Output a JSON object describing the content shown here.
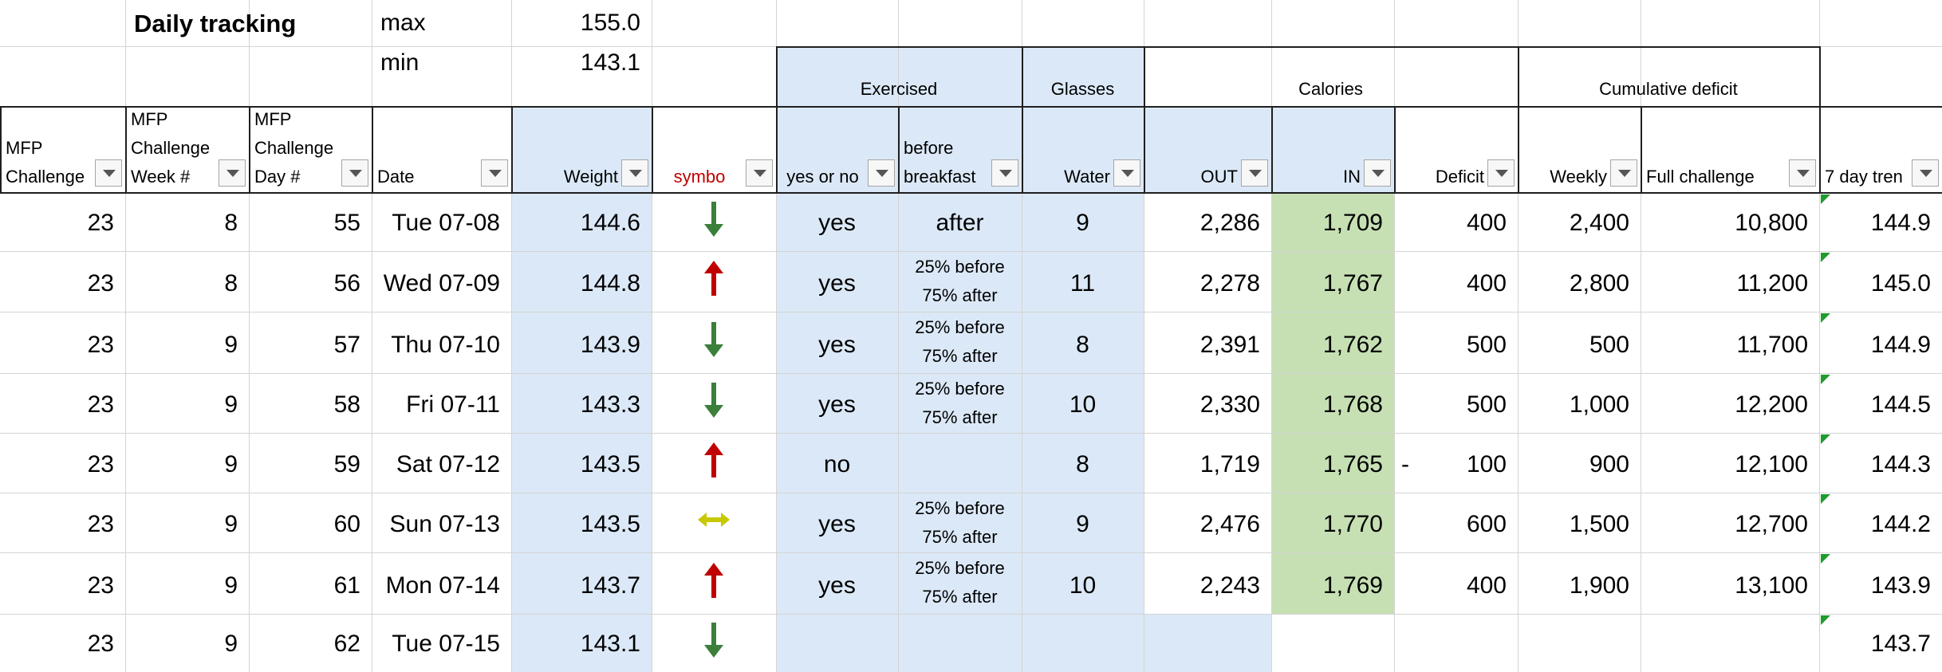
{
  "summary": {
    "title": "Daily tracking",
    "max_label": "max",
    "max_value": "155.0",
    "min_label": "min",
    "min_value": "143.1"
  },
  "group_headers": {
    "exercised": "Exercised",
    "glasses": "Glasses",
    "calories": "Calories",
    "cumulative_deficit": "Cumulative deficit"
  },
  "columns": [
    {
      "key": "challenge",
      "lines": [
        "MFP",
        "Challenge"
      ],
      "align": "l"
    },
    {
      "key": "week",
      "lines": [
        "MFP",
        "Challenge",
        "Week #"
      ],
      "align": "l"
    },
    {
      "key": "day",
      "lines": [
        "MFP",
        "Challenge",
        "Day #"
      ],
      "align": "l"
    },
    {
      "key": "date",
      "lines": [
        "Date"
      ],
      "align": "l"
    },
    {
      "key": "weight",
      "lines": [
        "Weight"
      ],
      "align": "r"
    },
    {
      "key": "symbol",
      "lines": [
        "symbo"
      ],
      "align": "c",
      "color": "red"
    },
    {
      "key": "exercised",
      "lines": [
        "yes or no"
      ],
      "align": "c"
    },
    {
      "key": "before_breakfast",
      "lines": [
        "before",
        "breakfast"
      ],
      "align": "l"
    },
    {
      "key": "water",
      "lines": [
        "Water"
      ],
      "align": "r"
    },
    {
      "key": "out",
      "lines": [
        "OUT"
      ],
      "align": "r"
    },
    {
      "key": "in",
      "lines": [
        "IN"
      ],
      "align": "r"
    },
    {
      "key": "deficit",
      "lines": [
        "Deficit"
      ],
      "align": "r"
    },
    {
      "key": "weekly",
      "lines": [
        "Weekly"
      ],
      "align": "r"
    },
    {
      "key": "full",
      "lines": [
        "Full challenge"
      ],
      "align": "l"
    },
    {
      "key": "trend",
      "lines": [
        "7 day tren"
      ],
      "align": "l"
    }
  ],
  "rows": [
    {
      "challenge": "23",
      "week": "8",
      "day": "55",
      "date": "Tue 07-08",
      "weight": "144.6",
      "symbol": "down",
      "exercised": "yes",
      "before_breakfast": [
        "after"
      ],
      "water": "9",
      "out": "2,286",
      "in": "1,709",
      "deficit_sign": "",
      "deficit": "400",
      "weekly": "2,400",
      "full": "10,800",
      "trend": "144.9"
    },
    {
      "challenge": "23",
      "week": "8",
      "day": "56",
      "date": "Wed 07-09",
      "weight": "144.8",
      "symbol": "up",
      "exercised": "yes",
      "before_breakfast": [
        "25% before",
        "75% after"
      ],
      "water": "11",
      "out": "2,278",
      "in": "1,767",
      "deficit_sign": "",
      "deficit": "400",
      "weekly": "2,800",
      "full": "11,200",
      "trend": "145.0"
    },
    {
      "challenge": "23",
      "week": "9",
      "day": "57",
      "date": "Thu 07-10",
      "weight": "143.9",
      "symbol": "down",
      "exercised": "yes",
      "before_breakfast": [
        "25% before",
        "75% after"
      ],
      "water": "8",
      "out": "2,391",
      "in": "1,762",
      "deficit_sign": "",
      "deficit": "500",
      "weekly": "500",
      "full": "11,700",
      "trend": "144.9"
    },
    {
      "challenge": "23",
      "week": "9",
      "day": "58",
      "date": "Fri 07-11",
      "weight": "143.3",
      "symbol": "down",
      "exercised": "yes",
      "before_breakfast": [
        "25% before",
        "75% after"
      ],
      "water": "10",
      "out": "2,330",
      "in": "1,768",
      "deficit_sign": "",
      "deficit": "500",
      "weekly": "1,000",
      "full": "12,200",
      "trend": "144.5"
    },
    {
      "challenge": "23",
      "week": "9",
      "day": "59",
      "date": "Sat 07-12",
      "weight": "143.5",
      "symbol": "up",
      "exercised": "no",
      "before_breakfast": [],
      "water": "8",
      "out": "1,719",
      "in": "1,765",
      "deficit_sign": "-",
      "deficit": "100",
      "weekly": "900",
      "full": "12,100",
      "trend": "144.3"
    },
    {
      "challenge": "23",
      "week": "9",
      "day": "60",
      "date": "Sun 07-13",
      "weight": "143.5",
      "symbol": "side",
      "exercised": "yes",
      "before_breakfast": [
        "25% before",
        "75% after"
      ],
      "water": "9",
      "out": "2,476",
      "in": "1,770",
      "deficit_sign": "",
      "deficit": "600",
      "weekly": "1,500",
      "full": "12,700",
      "trend": "144.2"
    },
    {
      "challenge": "23",
      "week": "9",
      "day": "61",
      "date": "Mon 07-14",
      "weight": "143.7",
      "symbol": "up",
      "exercised": "yes",
      "before_breakfast": [
        "25% before",
        "75% after"
      ],
      "water": "10",
      "out": "2,243",
      "in": "1,769",
      "deficit_sign": "",
      "deficit": "400",
      "weekly": "1,900",
      "full": "13,100",
      "trend": "143.9"
    },
    {
      "challenge": "23",
      "week": "9",
      "day": "62",
      "date": "Tue 07-15",
      "weight": "143.1",
      "symbol": "down",
      "exercised": "",
      "before_breakfast": [],
      "water": "",
      "out": "",
      "in": "",
      "deficit_sign": "",
      "deficit": "",
      "weekly": "",
      "full": "",
      "trend": "143.7"
    }
  ],
  "icons": {
    "filter": "dropdown-arrow-icon",
    "down": "green-down-arrow-icon",
    "up": "red-up-arrow-icon",
    "side": "yellow-sideways-arrow-icon",
    "comment": "green-corner-indicator-icon"
  },
  "colors": {
    "input_fill": "#dbe8f7",
    "calories_in_fill": "#c6e0b4",
    "arrow_up": "#c00000",
    "arrow_down": "#3b7f3b",
    "arrow_side": "#c8c800",
    "header_symbol_text": "#c00000",
    "corner_indicator": "#1e9c2e"
  }
}
